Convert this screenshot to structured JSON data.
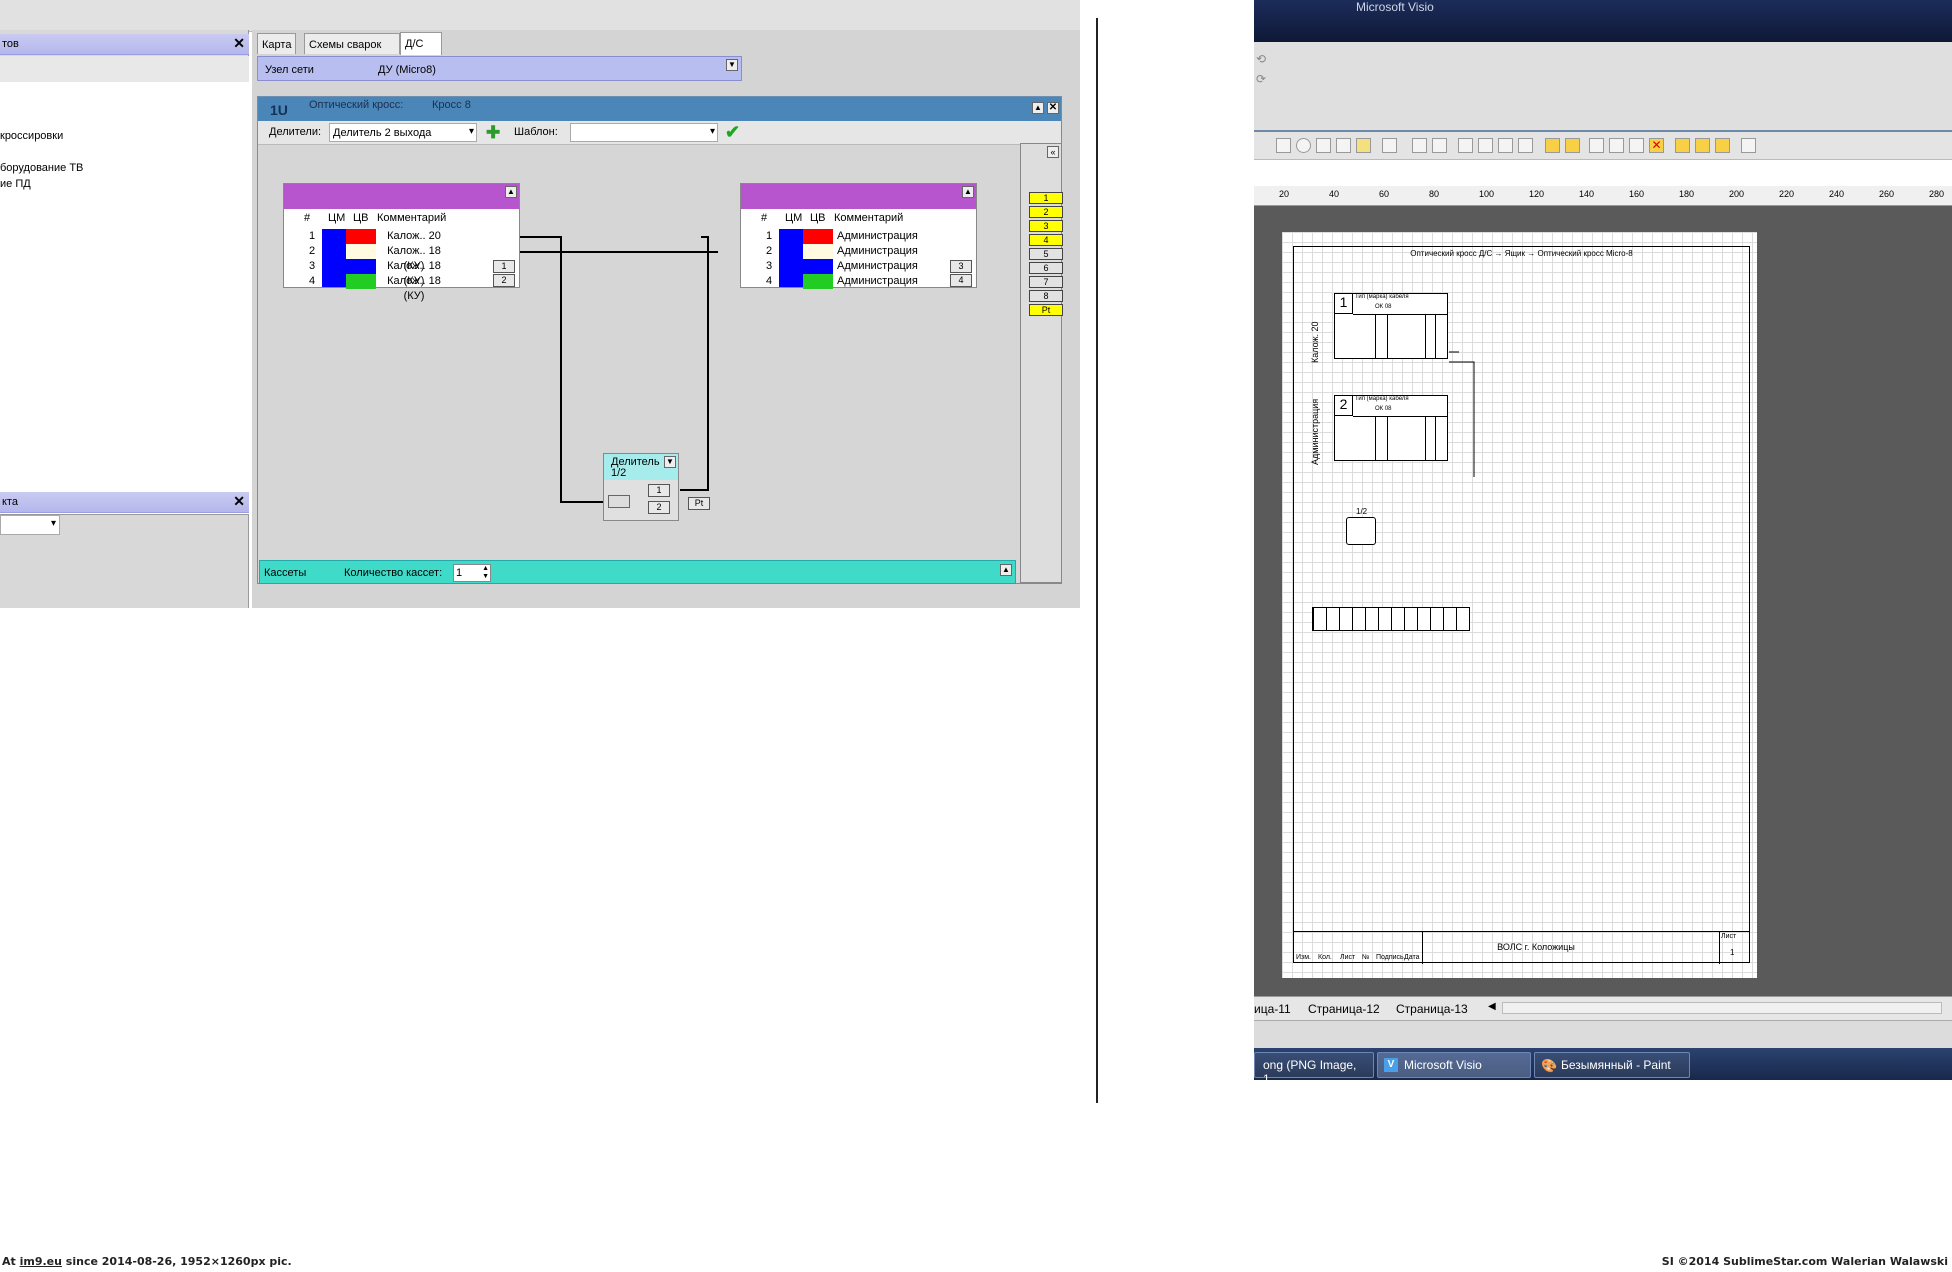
{
  "left_app": {
    "panel1_title": "тов",
    "tree_items": [
      "кроссировки",
      "",
      "борудование ТВ",
      "ие ПД"
    ],
    "panel2_title": "кта",
    "tabs": [
      "Карта",
      "Схемы сварок",
      "Д/С"
    ],
    "node": {
      "label": "Узел сети",
      "value": "ДУ (Micro8)"
    },
    "cross": {
      "unit": "1U",
      "label": "Оптический кросс:",
      "value": "Кросс 8",
      "splitters_label": "Делители:",
      "splitters_value": "Делитель 2 выхода",
      "template_label": "Шаблон:",
      "template_value": ""
    },
    "columns": [
      "#",
      "ЦМ",
      "ЦВ",
      "Комментарий"
    ],
    "left_frame": {
      "rows": [
        {
          "n": "1",
          "comment": "Калож.. 20",
          "fiber_color": "#ff0000"
        },
        {
          "n": "2",
          "comment": "Калож.. 18 (КУ)",
          "fiber_color": "#fffbe0"
        },
        {
          "n": "3",
          "comment": "Калож.. 18 (КУ)",
          "fiber_color": "#0000ff"
        },
        {
          "n": "4",
          "comment": "Калож.. 18 (КУ)",
          "fiber_color": "#22cc22"
        }
      ],
      "ports": [
        "1",
        "2"
      ]
    },
    "right_frame": {
      "rows": [
        {
          "n": "1",
          "comment": "Администрация",
          "fiber_color": "#ff0000"
        },
        {
          "n": "2",
          "comment": "Администрация",
          "fiber_color": "#fffbe0"
        },
        {
          "n": "3",
          "comment": "Администрация",
          "fiber_color": "#0000ff"
        },
        {
          "n": "4",
          "comment": "Администрация",
          "fiber_color": "#22cc22"
        }
      ],
      "ports": [
        "3",
        "4"
      ]
    },
    "splitter": {
      "title": "Делитель",
      "ratio": "1/2",
      "outputs": [
        "1",
        "2"
      ],
      "pt": "Pt"
    },
    "port_list": [
      "1",
      "2",
      "3",
      "4",
      "5",
      "6",
      "7",
      "8",
      "Pt"
    ],
    "cassettes": {
      "label": "Кассеты",
      "count_label": "Количество кассет:",
      "count_value": "1"
    }
  },
  "visio": {
    "title": "Microsoft Visio",
    "ruler": [
      "20",
      "40",
      "60",
      "80",
      "100",
      "120",
      "140",
      "160",
      "180",
      "200",
      "220",
      "240",
      "260",
      "280"
    ],
    "sheet_title": "Оптический кросс Д/С → Ящик → Оптический кросс Micro-8",
    "block1_num": "1",
    "block1_side": "Калож. 20",
    "block2_num": "2",
    "block2_side": "Администрация",
    "block_header": "Тип (марка) кабеля",
    "block_sub": "ОК 08",
    "splitter_ratio": "1/2",
    "stamp_title": "ВОЛС г. Коложицы",
    "stamp_sheet_label": "Лист",
    "stamp_sheet_value": "1",
    "stamp_cols": [
      "Изм.",
      "Кол.",
      "Лист",
      "№",
      "Подпись",
      "Дата"
    ],
    "page_tabs": [
      "ица-11",
      "Страница-12",
      "Страница-13"
    ],
    "taskbar": [
      "ong (PNG Image, 1...",
      "Microsoft Visio",
      "Безымянный - Paint"
    ]
  },
  "footer": {
    "left_prefix": "At ",
    "left_link": "im9.eu",
    "left_suffix": " since 2014-08-26, 1952×1260px pic.",
    "right": "SI ©2014 SublimeStar.com Walerian Walawski"
  },
  "colors": {
    "cm": "#0000ff",
    "frame_head": "#b755cf",
    "cross_head": "#4b86b8",
    "cassettes": "#3fdac8",
    "port_yellow": "#ffff00"
  }
}
